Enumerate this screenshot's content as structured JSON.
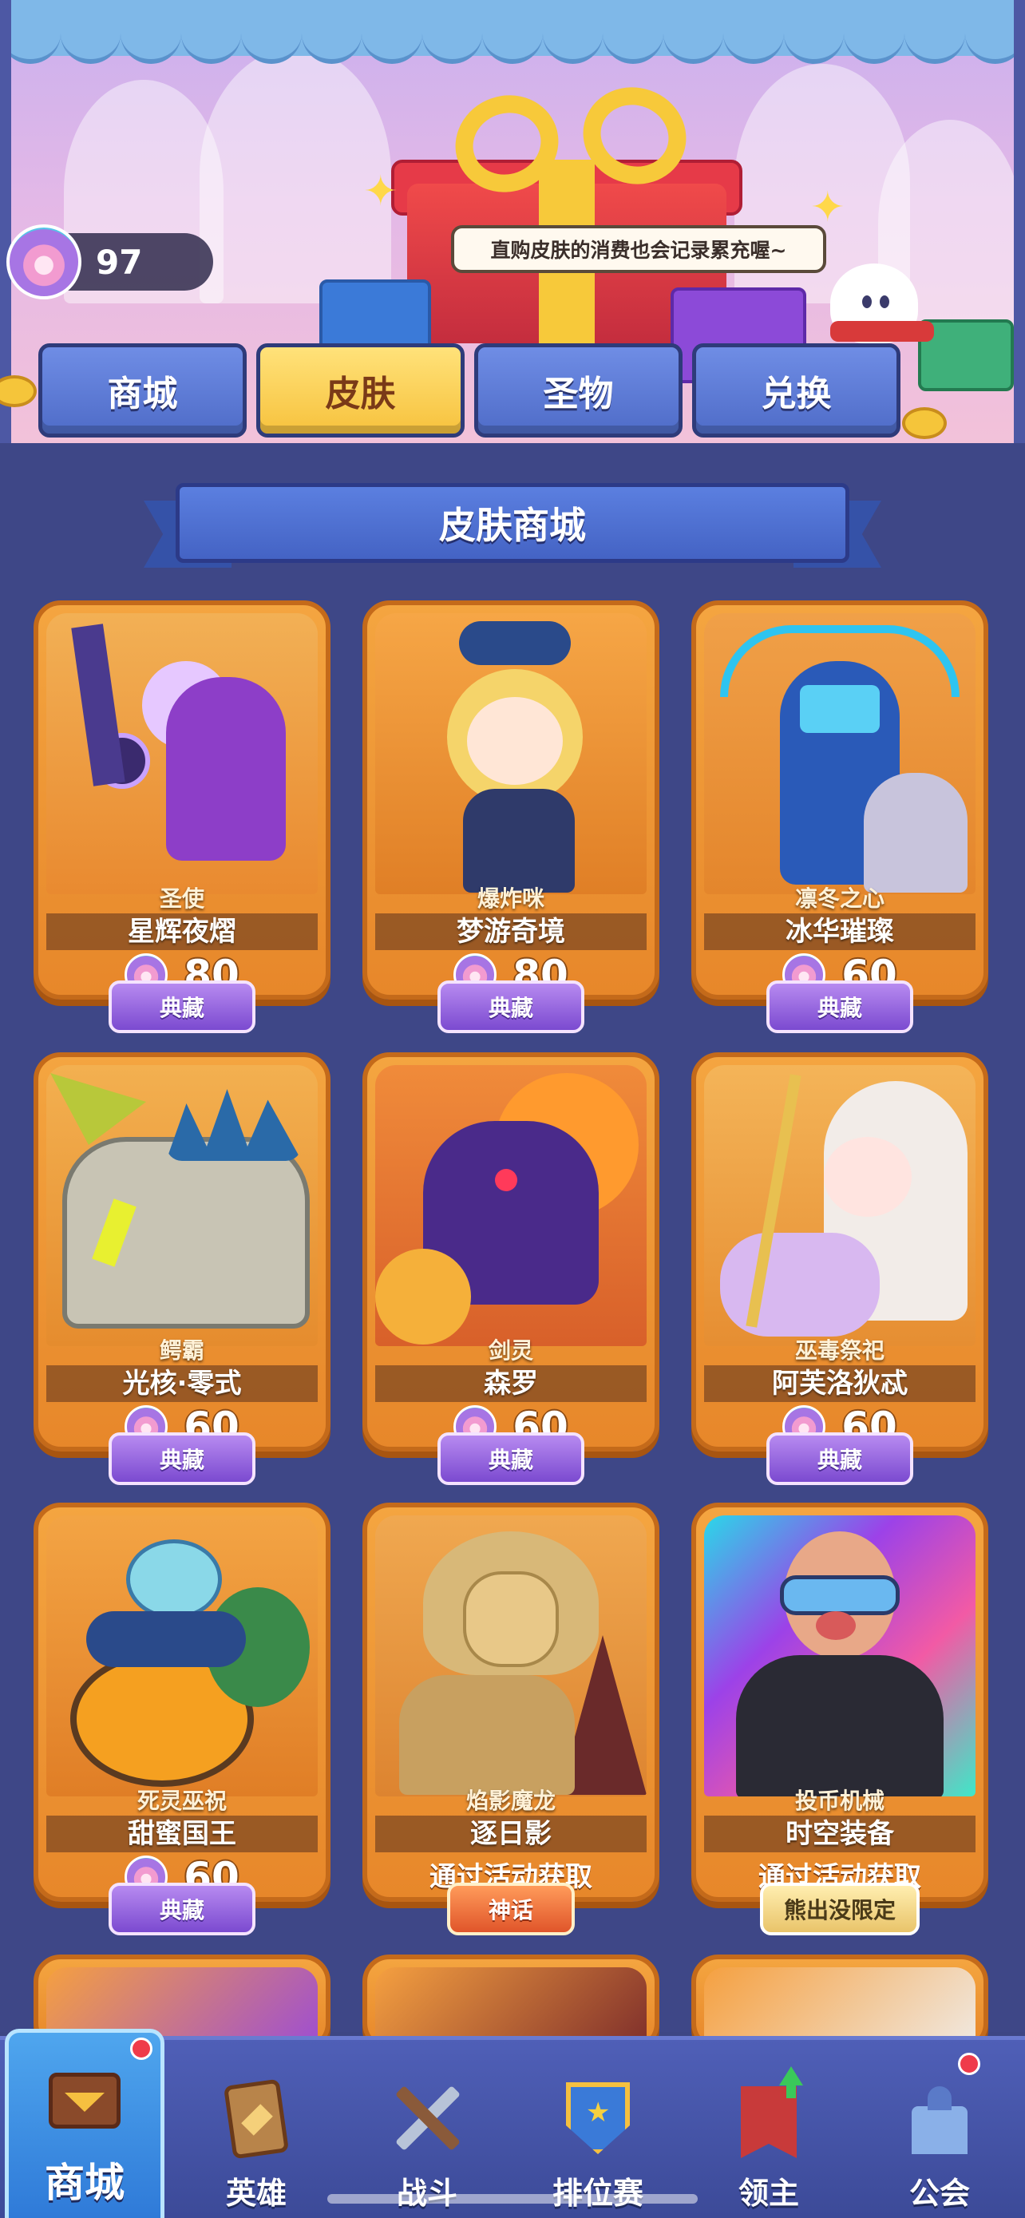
{
  "currency": {
    "amount": "97",
    "icon": "pearl-icon"
  },
  "banner": {
    "speech": "直购皮肤的消费也会记录累充喔~"
  },
  "tabs": [
    {
      "label": "商城",
      "active": false
    },
    {
      "label": "皮肤",
      "active": true
    },
    {
      "label": "圣物",
      "active": false
    },
    {
      "label": "兑换",
      "active": false
    }
  ],
  "section_title": "皮肤商城",
  "skins": [
    {
      "hero": "圣使",
      "name": "星辉夜熠",
      "price": "80",
      "badge": "典藏"
    },
    {
      "hero": "爆炸咪",
      "name": "梦游奇境",
      "price": "80",
      "badge": "典藏"
    },
    {
      "hero": "凛冬之心",
      "name": "冰华璀璨",
      "price": "60",
      "badge": "典藏"
    },
    {
      "hero": "鳄霸",
      "name": "光核·零式",
      "price": "60",
      "badge": "典藏"
    },
    {
      "hero": "剑灵",
      "name": "森罗",
      "price": "60",
      "badge": "典藏"
    },
    {
      "hero": "巫毒祭祀",
      "name": "阿芙洛狄忒",
      "price": "60",
      "badge": "典藏"
    },
    {
      "hero": "死灵巫祝",
      "name": "甜蜜国王",
      "price": "60",
      "badge": "典藏"
    },
    {
      "hero": "焰影魔龙",
      "name": "逐日影",
      "obtain": "通过活动获取",
      "badge": "神话"
    },
    {
      "hero": "投币机械",
      "name": "时空装备",
      "obtain": "通过活动获取",
      "badge": "熊出没限定"
    }
  ],
  "nav": [
    {
      "label": "商城",
      "icon": "shop-chest-icon",
      "active": true
    },
    {
      "label": "英雄",
      "icon": "hero-card-icon",
      "active": false
    },
    {
      "label": "战斗",
      "icon": "crossed-swords-icon",
      "active": false
    },
    {
      "label": "排位赛",
      "icon": "rank-shield-icon",
      "active": false
    },
    {
      "label": "领主",
      "icon": "lord-banner-icon",
      "active": false
    },
    {
      "label": "公会",
      "icon": "guild-castle-icon",
      "active": false
    }
  ],
  "colors": {
    "background": "#3e4787",
    "card_orange": "#f4a540",
    "tab_active": "#f7c23d",
    "tab_inactive": "#5a78d6",
    "nav_active": "#2f7ad8"
  }
}
